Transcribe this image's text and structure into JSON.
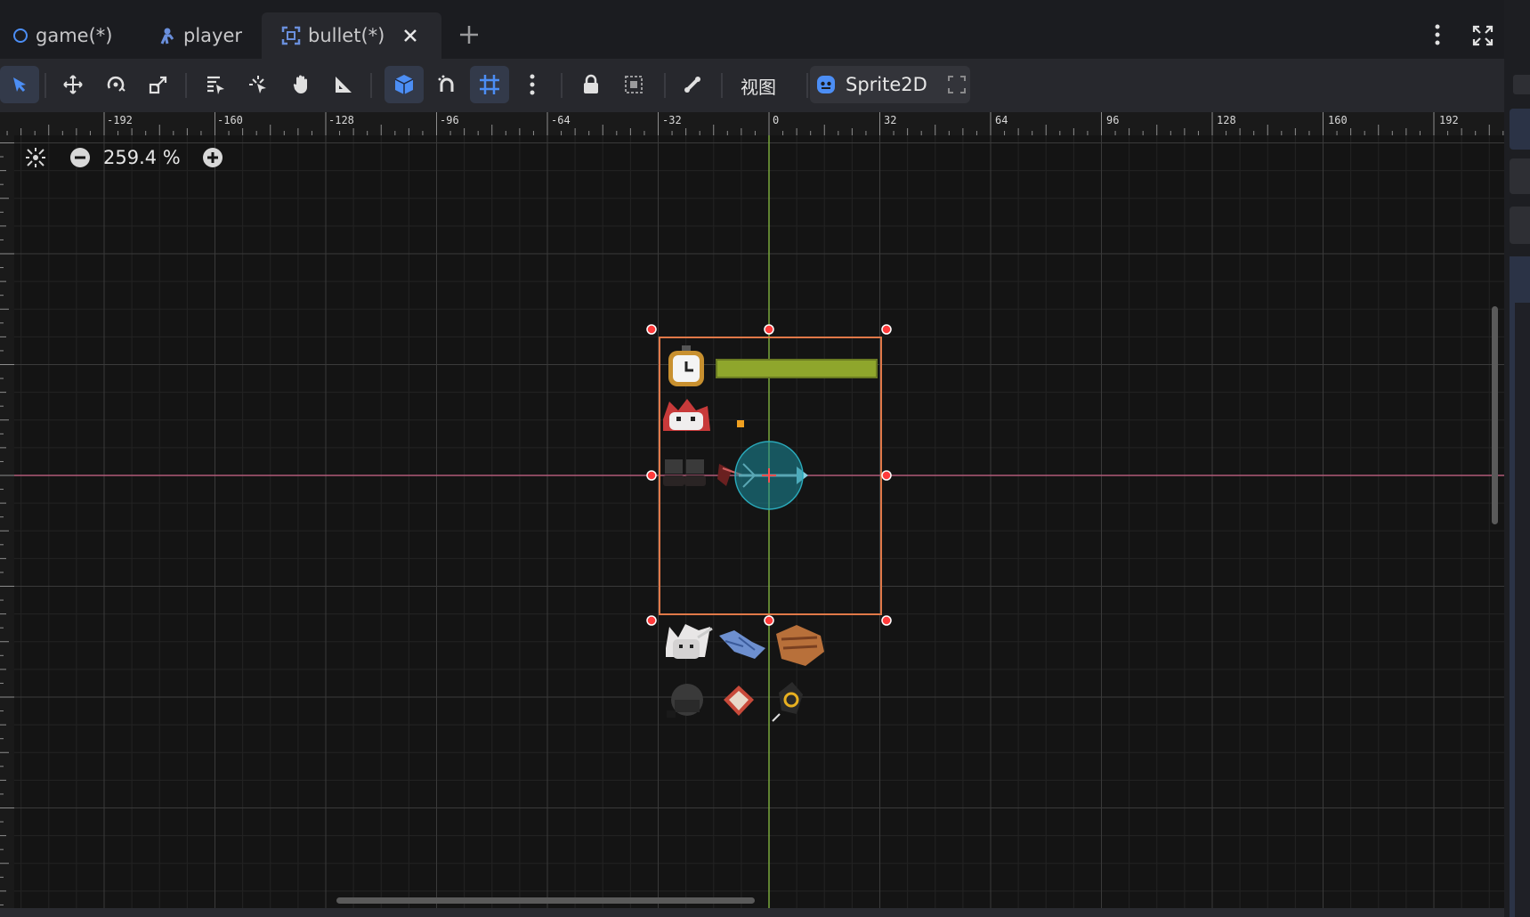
{
  "tabs": [
    {
      "label": "game(*)",
      "icon": "circle-node-icon"
    },
    {
      "label": "player",
      "icon": "character-body-icon"
    },
    {
      "label": "bullet(*)",
      "icon": "area-node-icon",
      "active": true
    }
  ],
  "toolbar": {
    "view_menu_label": "视图",
    "node_type_label": "Sprite2D"
  },
  "zoom": {
    "value": "259.4 %"
  },
  "ruler": {
    "labels": [
      "-192",
      "-160",
      "-128",
      "-96",
      "-64",
      "-32",
      "0",
      "32",
      "64",
      "96",
      "128",
      "160",
      "192"
    ]
  },
  "colors": {
    "accent": "#4c8ef5",
    "selection_box": "#e07848",
    "handle": "#ff3b3b",
    "x_axis": "#b05a78",
    "y_axis": "#7aa83c",
    "collision_shape": "#1a8c9c",
    "progress_bar": "#8fa62c"
  }
}
